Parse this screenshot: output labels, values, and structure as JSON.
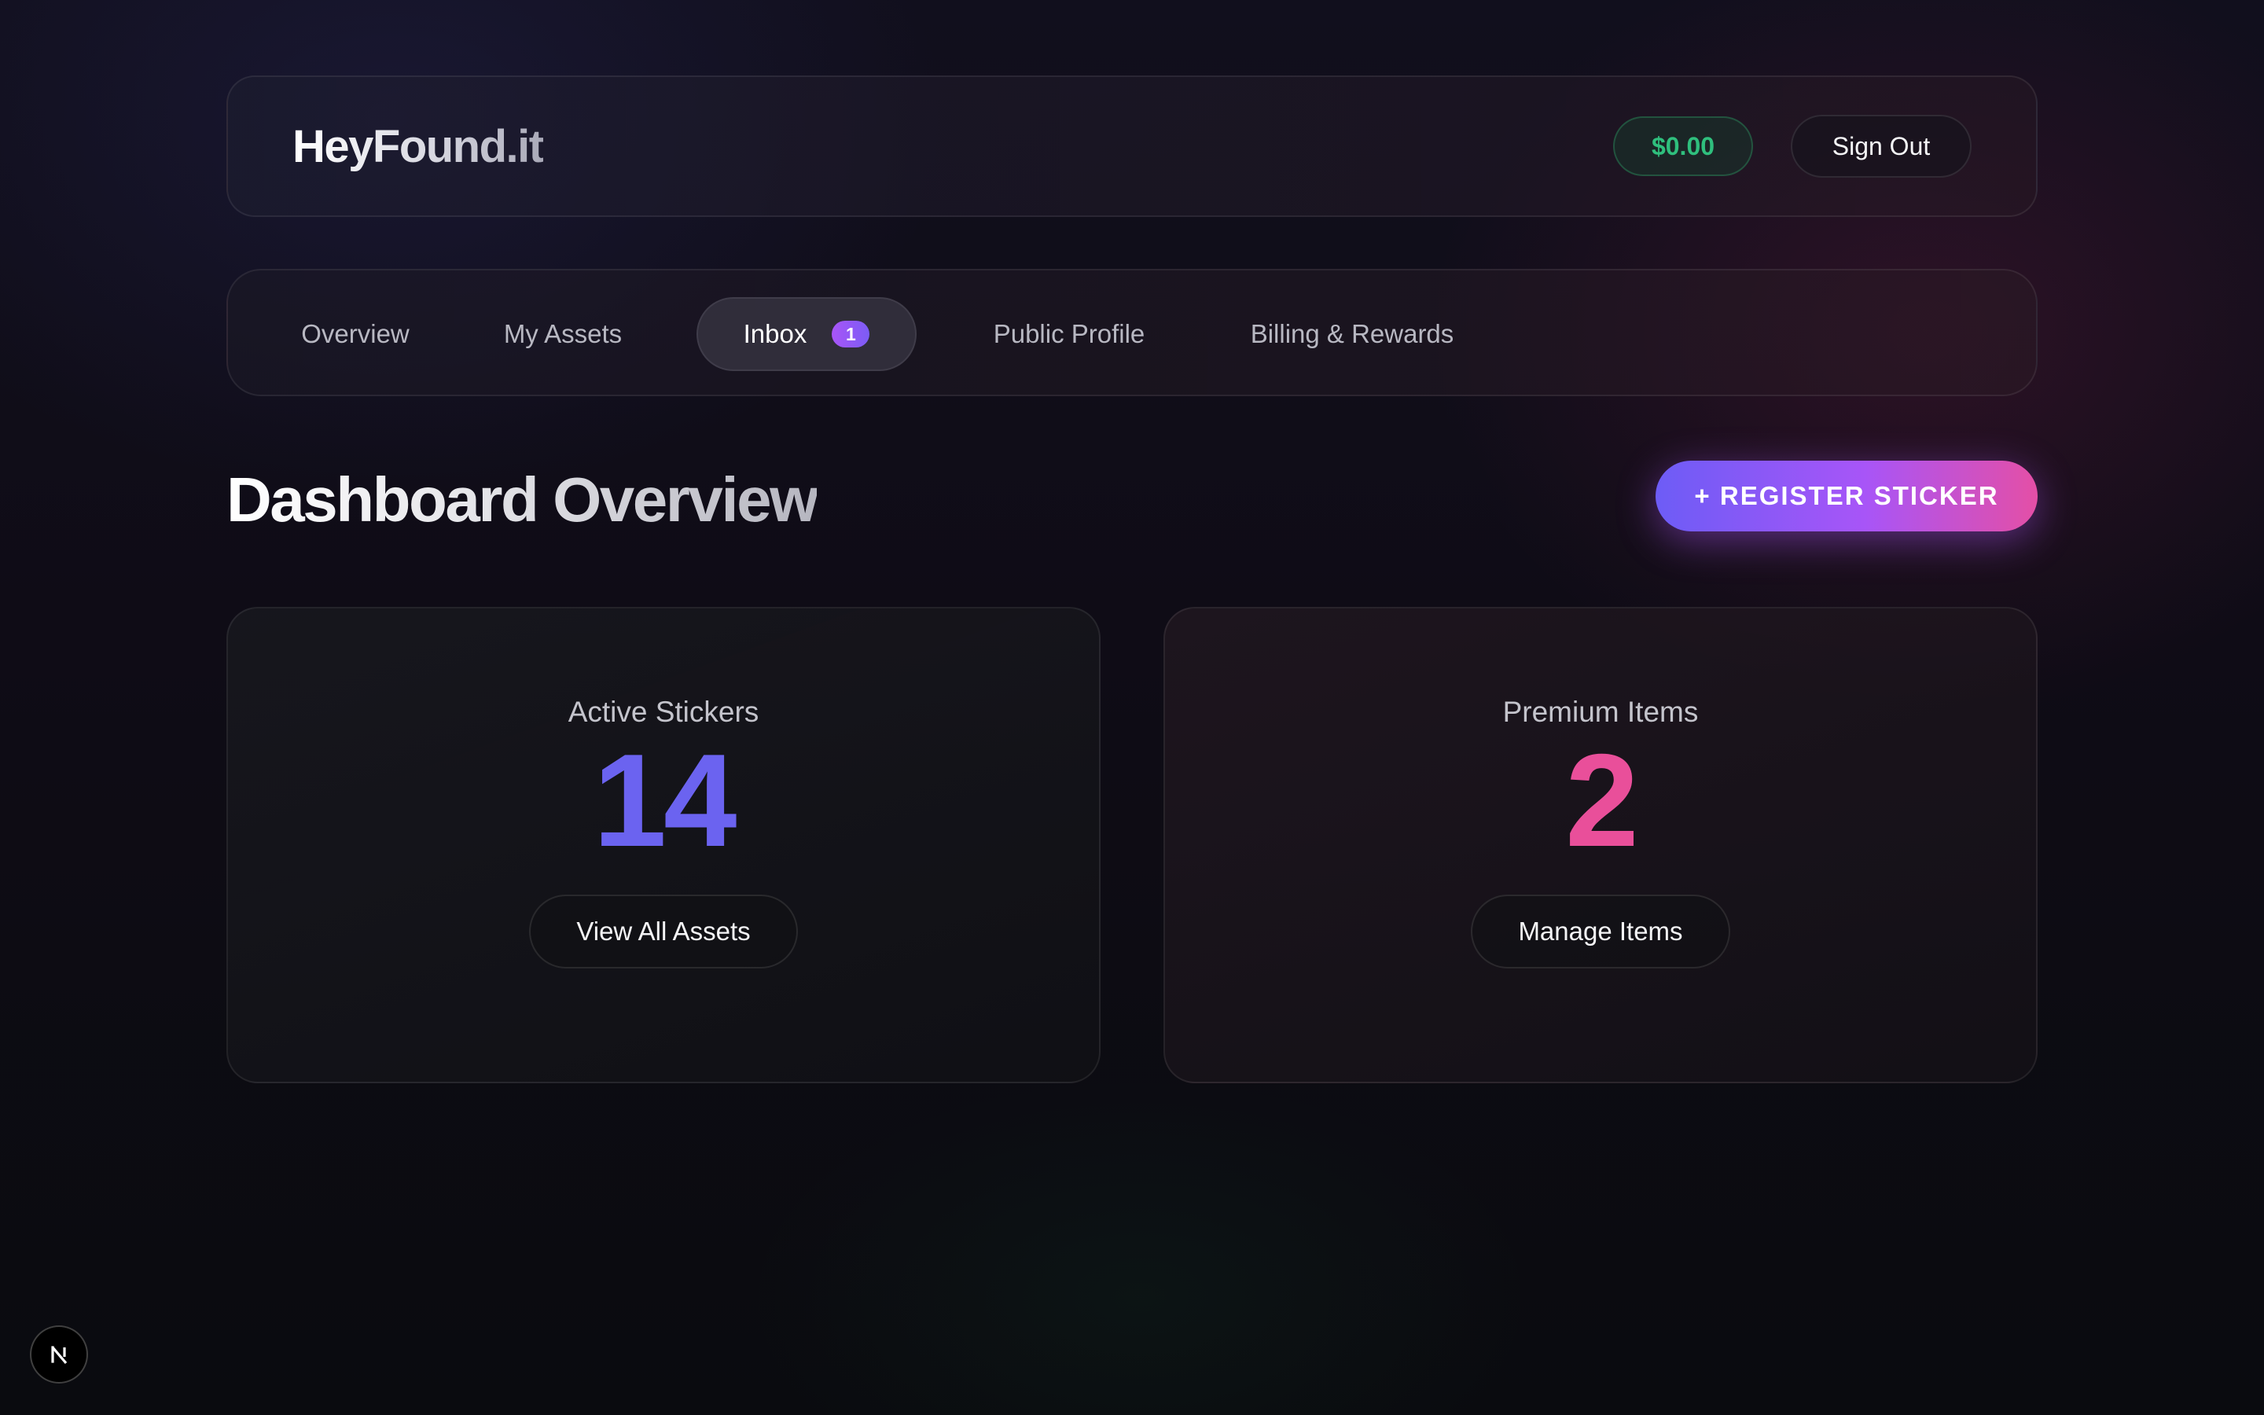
{
  "header": {
    "brand": "HeyFound.it",
    "balance": "$0.00",
    "signout_label": "Sign Out"
  },
  "nav": {
    "tabs": [
      {
        "label": "Overview",
        "active": false
      },
      {
        "label": "My Assets",
        "active": false
      },
      {
        "label": "Inbox",
        "active": true,
        "badge": "1"
      },
      {
        "label": "Public Profile",
        "active": false
      },
      {
        "label": "Billing & Rewards",
        "active": false
      }
    ]
  },
  "main": {
    "title": "Dashboard Overview",
    "register_label": "+ REGISTER STICKER",
    "cards": [
      {
        "label": "Active Stickers",
        "value": "14",
        "button": "View All Assets",
        "accent": "#6b63f0"
      },
      {
        "label": "Premium Items",
        "value": "2",
        "button": "Manage Items",
        "accent": "#e94f9a"
      }
    ]
  },
  "dev_indicator": {
    "icon": "nextjs-logo-icon"
  },
  "colors": {
    "balance_green": "#2fbf7d",
    "gradient_start": "#6d5cf6",
    "gradient_mid": "#a855f7",
    "gradient_end": "#e44fa6"
  }
}
